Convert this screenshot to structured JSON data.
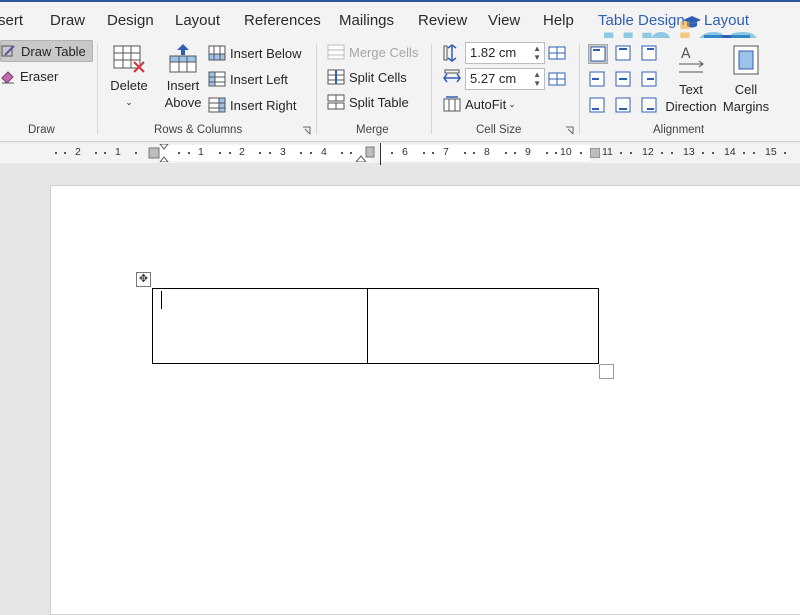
{
  "tabs": [
    {
      "label": "sert"
    },
    {
      "label": "Draw"
    },
    {
      "label": "Design"
    },
    {
      "label": "Layout"
    },
    {
      "label": "References"
    },
    {
      "label": "Mailings"
    },
    {
      "label": "Review"
    },
    {
      "label": "View"
    },
    {
      "label": "Help"
    },
    {
      "label": "Table Design"
    },
    {
      "label": "Layout"
    }
  ],
  "watermark": {
    "text_pre": "un",
    "text_o": "i",
    "text_post": "ca"
  },
  "ribbon": {
    "draw": {
      "draw_table": "Draw Table",
      "eraser": "Eraser",
      "group_label": "Draw"
    },
    "rows_columns": {
      "delete": "Delete",
      "insert_above_1": "Insert",
      "insert_above_2": "Above",
      "insert_below": "Insert Below",
      "insert_left": "Insert Left",
      "insert_right": "Insert Right",
      "group_label": "Rows & Columns"
    },
    "merge": {
      "merge_cells": "Merge Cells",
      "split_cells": "Split Cells",
      "split_table": "Split Table",
      "group_label": "Merge"
    },
    "cell_size": {
      "height_value": "1.82 cm",
      "width_value": "5.27 cm",
      "autofit": "AutoFit",
      "group_label": "Cell Size"
    },
    "alignment": {
      "text_direction_1": "Text",
      "text_direction_2": "Direction",
      "cell_margins_1": "Cell",
      "cell_margins_2": "Margins",
      "group_label": "Alignment"
    }
  },
  "ruler": {
    "numbers": [
      "2",
      "1",
      "1",
      "2",
      "3",
      "4",
      "6",
      "7",
      "8",
      "9",
      "10",
      "11",
      "12",
      "13",
      "14",
      "15"
    ]
  },
  "colors": {
    "accent": "#2f5fb3",
    "ribbon_bg": "#f3f3f3",
    "selected": "#c8c8c8"
  }
}
